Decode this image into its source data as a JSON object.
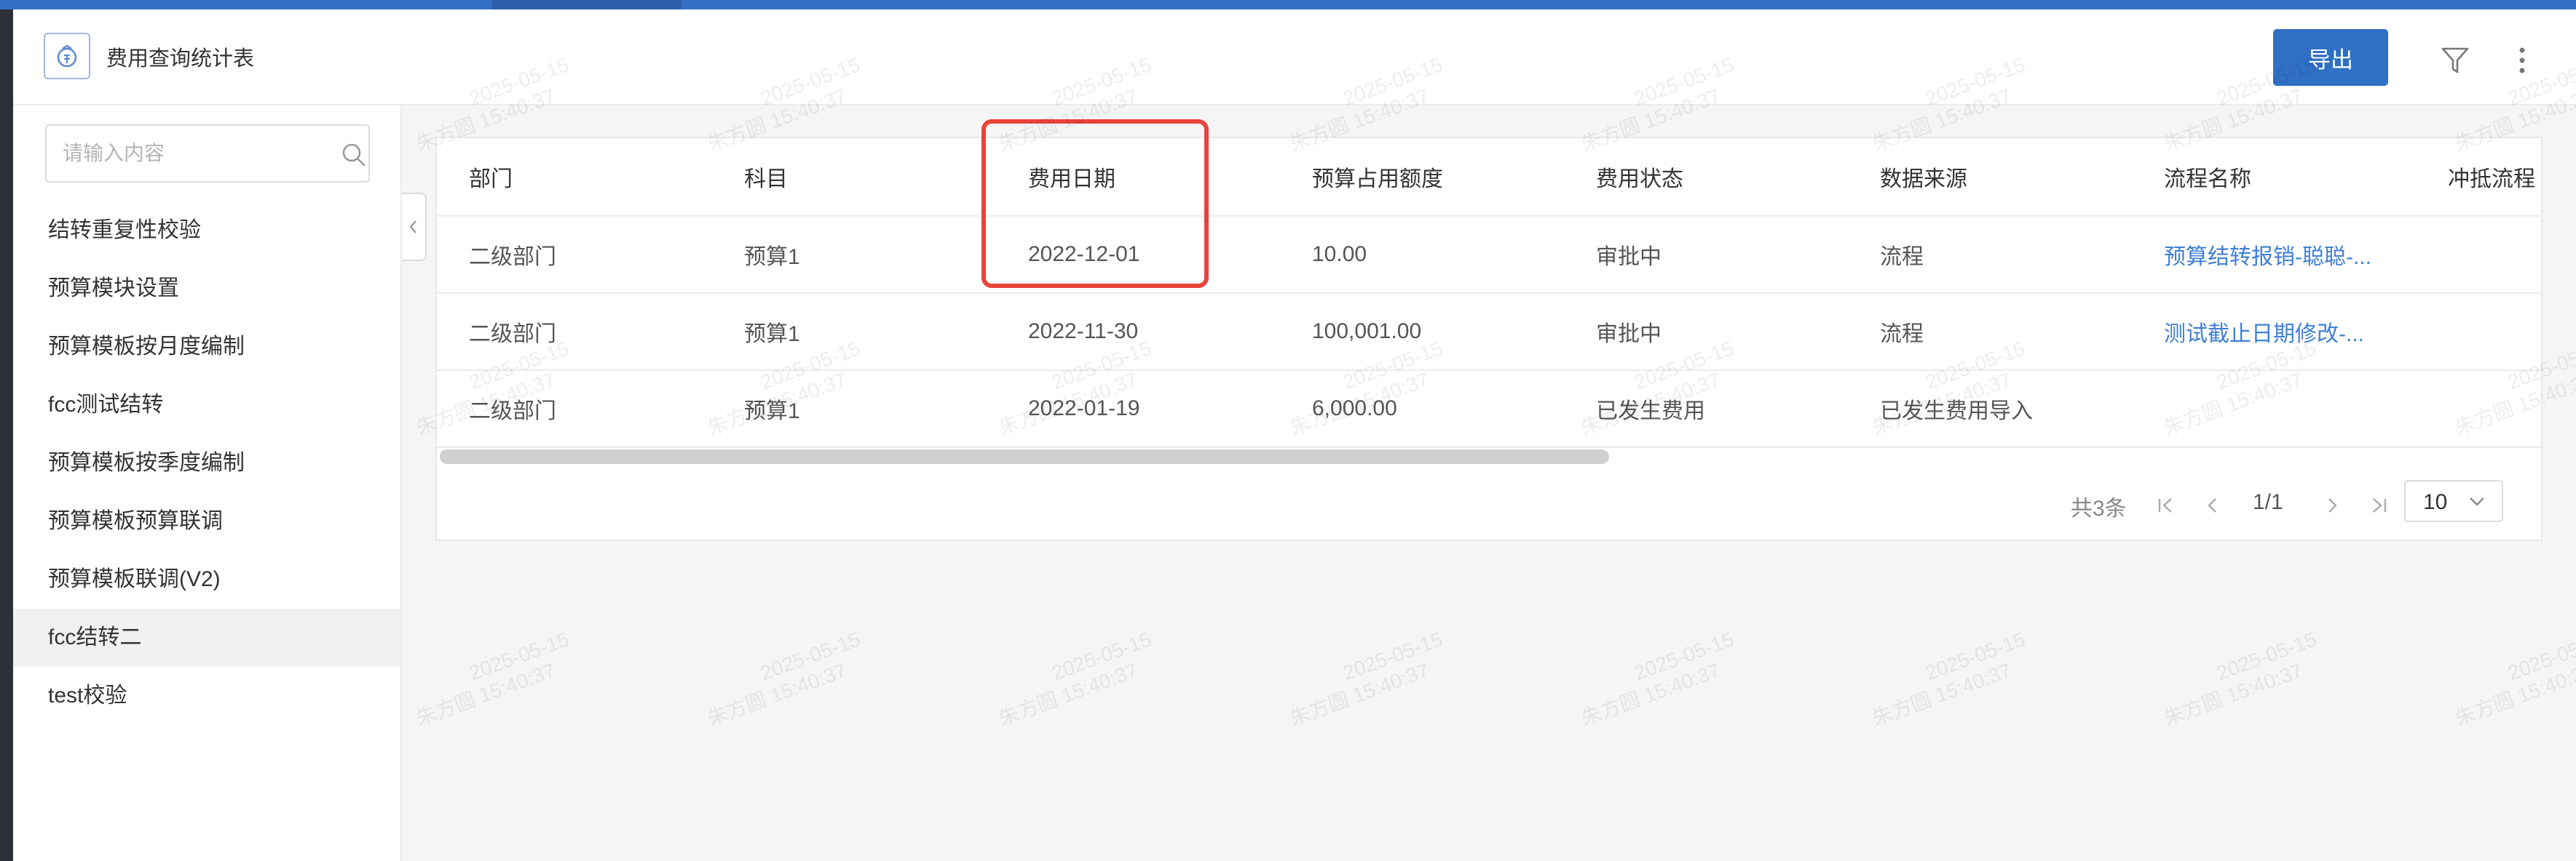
{
  "app": {
    "title": "费用查询统计表"
  },
  "toolbar": {
    "export_label": "导出"
  },
  "sidebar": {
    "search_placeholder": "请输入内容",
    "items": [
      {
        "label": "结转重复性校验"
      },
      {
        "label": "预算模块设置"
      },
      {
        "label": "预算模板按月度编制"
      },
      {
        "label": "fcc测试结转"
      },
      {
        "label": "预算模板按季度编制"
      },
      {
        "label": "预算模板预算联调"
      },
      {
        "label": "预算模板联调(V2)"
      },
      {
        "label": "fcc结转二",
        "active": true
      },
      {
        "label": "test校验"
      }
    ]
  },
  "table": {
    "columns": [
      "部门",
      "科目",
      "费用日期",
      "预算占用额度",
      "费用状态",
      "数据来源",
      "流程名称",
      "冲抵流程"
    ],
    "rows": [
      [
        "二级部门",
        "预算1",
        "2022-12-01",
        "10.00",
        "审批中",
        "流程",
        "预算结转报销-聪聪-...",
        ""
      ],
      [
        "二级部门",
        "预算1",
        "2022-11-30",
        "100,001.00",
        "审批中",
        "流程",
        "测试截止日期修改-...",
        ""
      ],
      [
        "二级部门",
        "预算1",
        "2022-01-19",
        "6,000.00",
        "已发生费用",
        "已发生费用导入",
        "",
        ""
      ]
    ],
    "highlighted_column": "费用日期"
  },
  "pagination": {
    "total_label": "共3条",
    "page_label": "1/1",
    "page_size": "10"
  },
  "watermark": {
    "name": "朱方圆",
    "date": "2025-05-15",
    "time": "15:40:37"
  },
  "colors": {
    "primary": "#2f6fc4",
    "link": "#3f7fd6",
    "highlight_box": "#e8433a",
    "topbar": "#3570c4"
  }
}
